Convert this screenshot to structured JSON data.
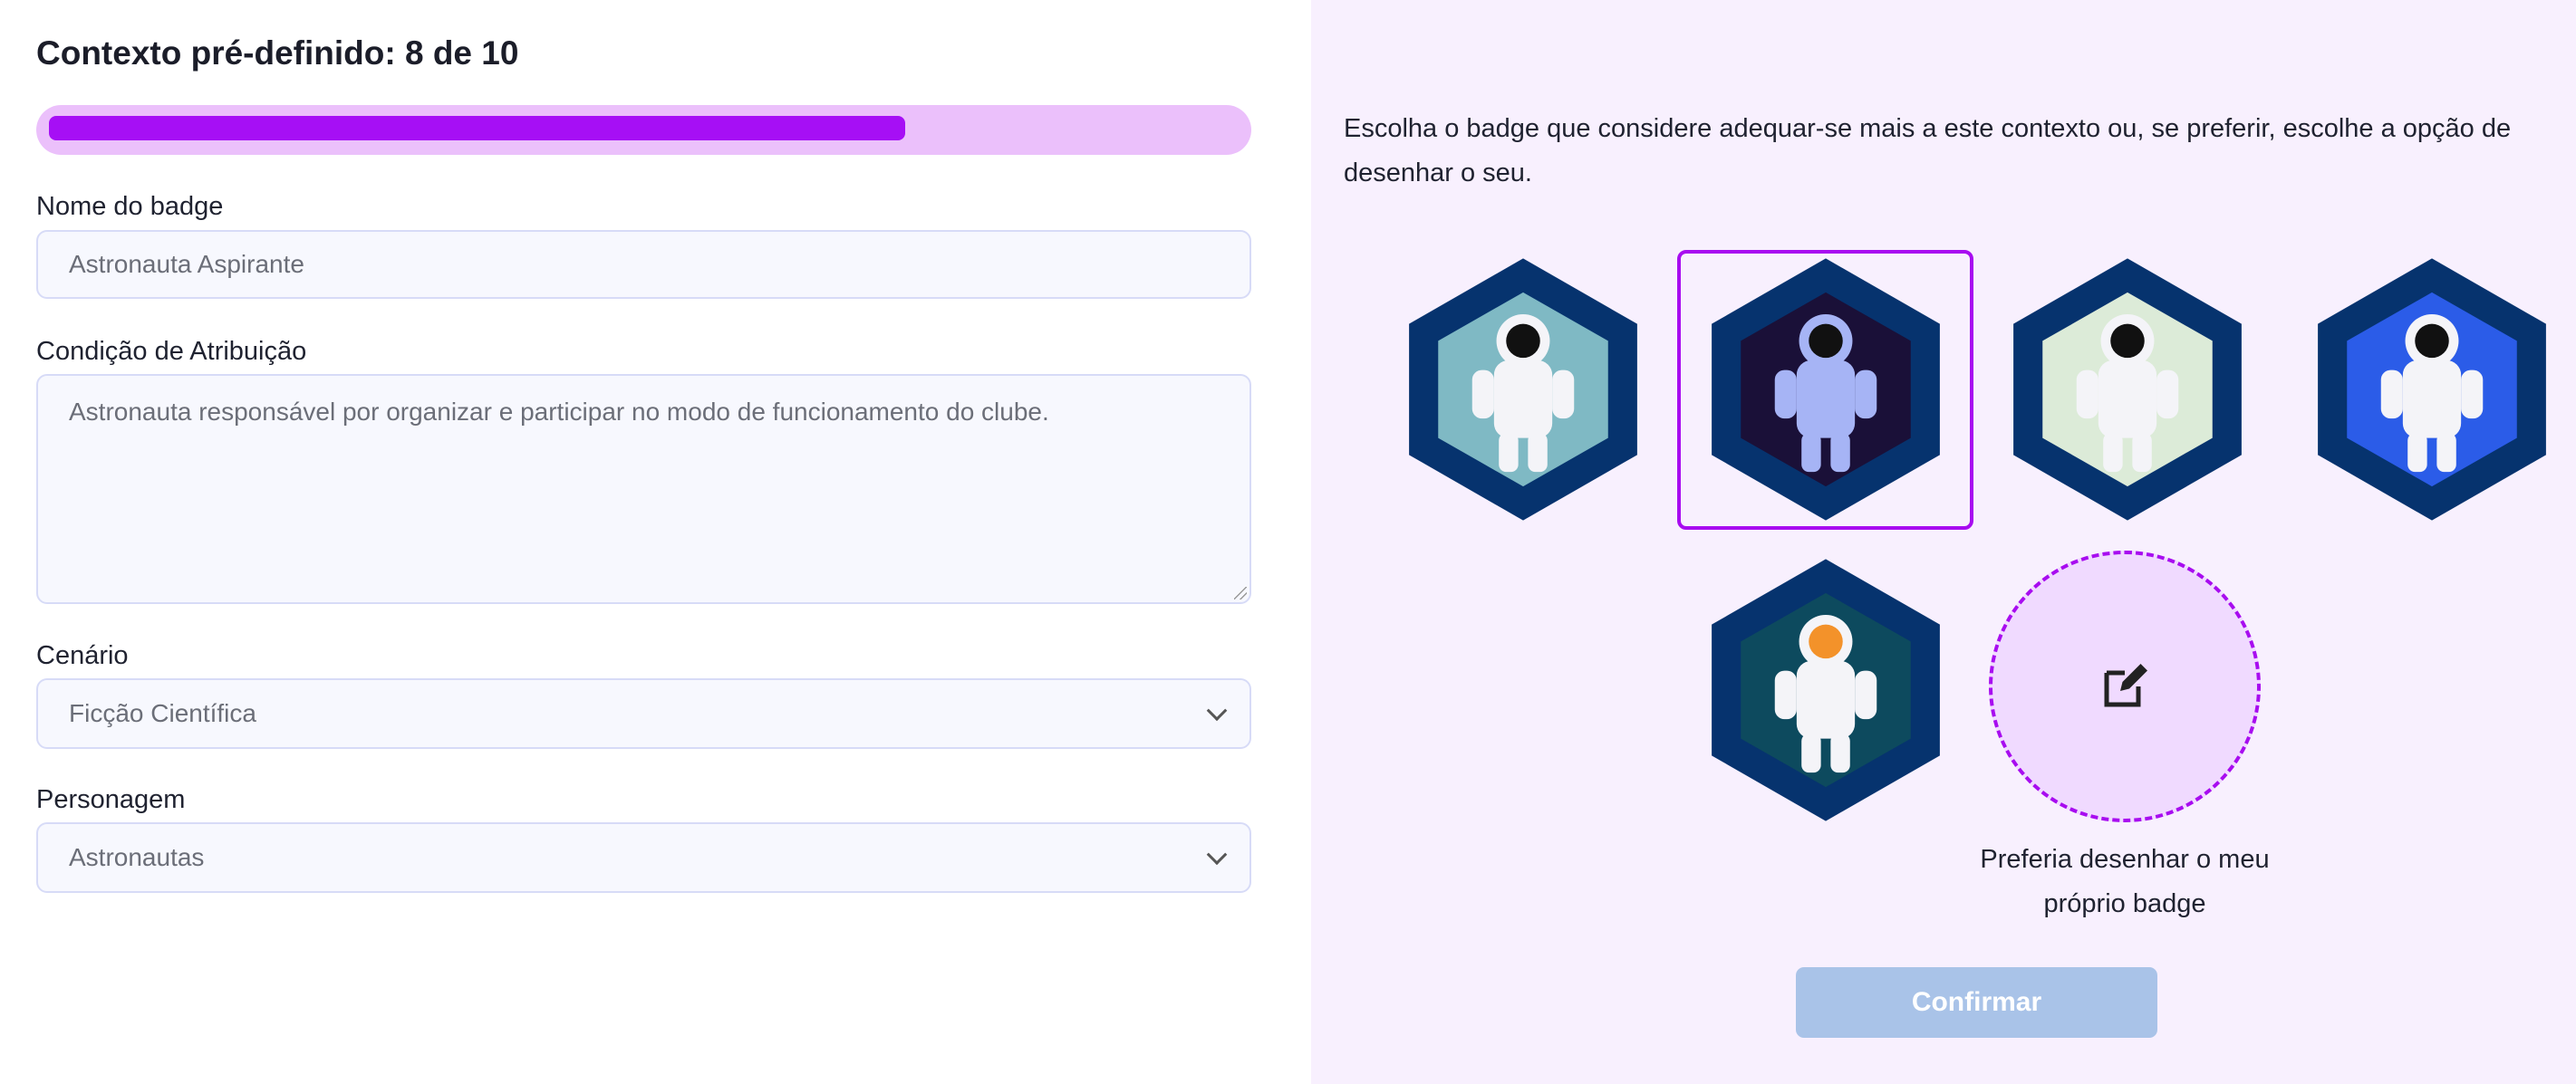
{
  "header": {
    "title": "Contexto pré-definido: 8 de 10",
    "progress": {
      "current": 8,
      "total": 10,
      "bar_fill_fraction": 0.72
    }
  },
  "form": {
    "badge_name": {
      "label": "Nome do badge",
      "value": "Astronauta Aspirante"
    },
    "condition": {
      "label": "Condição de Atribuição",
      "value": "Astronauta responsável por organizar e participar no modo de funcionamento do clube."
    },
    "scenario": {
      "label": "Cenário",
      "value": "Ficção Científica"
    },
    "character": {
      "label": "Personagem",
      "value": "Astronautas"
    }
  },
  "chooser": {
    "intro": "Escolha o badge que considere adequar-se mais a este contexto ou, se preferir, escolhe a opção de desenhar o seu.",
    "badges": [
      {
        "name": "astronaut-floating-planet",
        "bg": "#7fb9c4",
        "selected": false
      },
      {
        "name": "astronaut-dark",
        "bg": "#1a1038",
        "selected": true
      },
      {
        "name": "astronaut-portrait",
        "bg": "#dcebd8",
        "selected": false
      },
      {
        "name": "astronaut-blue",
        "bg": "#2b5ce8",
        "selected": false
      },
      {
        "name": "astronaut-pixel",
        "bg": "#0d4a5e",
        "selected": false
      }
    ],
    "draw_own_label": "Preferia desenhar o meu próprio badge",
    "confirm_label": "Confirmar"
  },
  "colors": {
    "accent": "#a60ff5",
    "hex_border": "#06336e",
    "confirm_disabled": "#a9c3e8"
  }
}
